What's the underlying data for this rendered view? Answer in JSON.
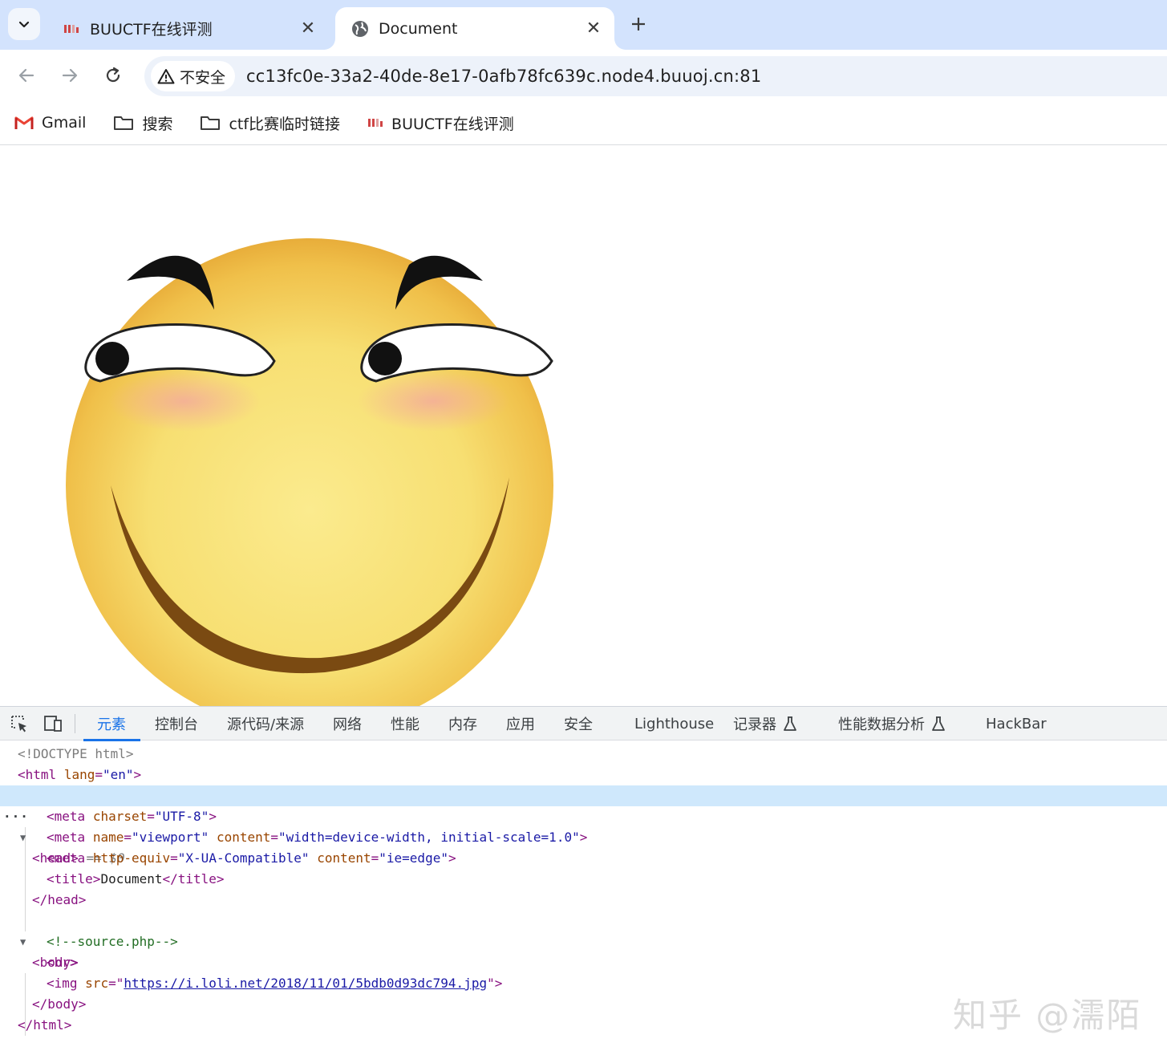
{
  "tabs": [
    {
      "title": "BUUCTF在线评测",
      "icon": "buuctf-favicon",
      "active": false
    },
    {
      "title": "Document",
      "icon": "globe-icon",
      "active": true
    }
  ],
  "toolbar": {
    "security_label": "不安全",
    "url": "cc13fc0e-33a2-40de-8e17-0afb78fc639c.node4.buuoj.cn:81"
  },
  "bookmarks": [
    {
      "label": "Gmail",
      "icon": "gmail-icon"
    },
    {
      "label": "搜索",
      "icon": "folder-icon"
    },
    {
      "label": "ctf比赛临时链接",
      "icon": "folder-icon"
    },
    {
      "label": "BUUCTF在线评测",
      "icon": "buuctf-favicon"
    }
  ],
  "page": {
    "image_alt": "smirking-emoji"
  },
  "devtools": {
    "tabs": [
      "元素",
      "控制台",
      "源代码/来源",
      "网络",
      "性能",
      "内存",
      "应用",
      "安全",
      "Lighthouse",
      "记录器",
      "性能数据分析",
      "HackBar"
    ],
    "active_tab": "元素",
    "dom": {
      "doctype": "<!DOCTYPE html>",
      "html_open_tag": "<html",
      "html_lang_attr": "lang",
      "html_lang_val": "\"en\"",
      "gt": ">",
      "head_open": "<head>",
      "selected_marker": "== $0",
      "meta1_tag": "<meta",
      "meta1_attr": "charset",
      "meta1_val": "\"UTF-8\"",
      "meta2_attr1": "name",
      "meta2_val1": "\"viewport\"",
      "meta2_attr2": "content",
      "meta2_val2": "\"width=device-width, initial-scale=1.0\"",
      "meta3_attr1": "http-equiv",
      "meta3_val1": "\"X-UA-Compatible\"",
      "meta3_attr2": "content",
      "meta3_val2": "\"ie=edge\"",
      "title_open": "<title>",
      "title_text": "Document",
      "title_close": "</title>",
      "head_close": "</head>",
      "body_open": "<body>",
      "comment": "<!--source.php-->",
      "br": "<br>",
      "img_tag": "<img",
      "img_attr": "src",
      "img_src": "https://i.loli.net/2018/11/01/5bdb0d93dc794.jpg",
      "body_close": "</body>",
      "html_close": "</html>"
    }
  },
  "watermark": "知乎 @濡陌",
  "colors": {
    "tabstrip_bg": "#d3e3fd",
    "omnibox_bg": "#edf2fa",
    "devtools_accent": "#1a73e8",
    "selected_row": "#cfe8fc"
  }
}
